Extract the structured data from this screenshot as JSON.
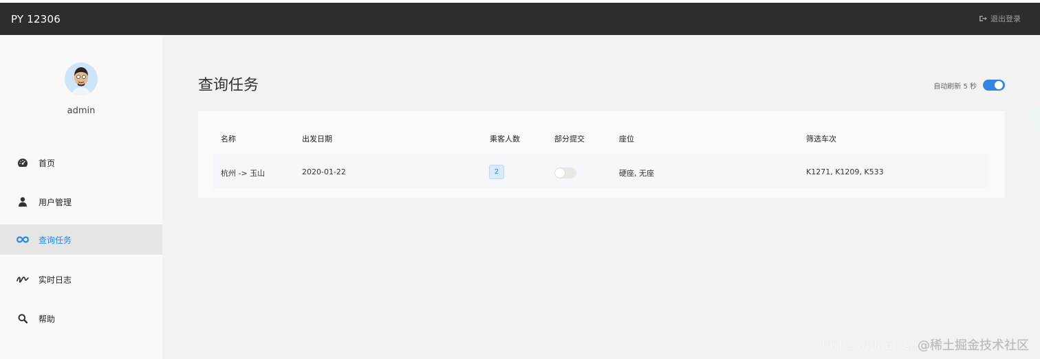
{
  "header": {
    "brand": "PY 12306",
    "logout_label": "退出登录"
  },
  "user": {
    "name": "admin"
  },
  "sidebar": {
    "items": [
      {
        "label": "首页",
        "icon": "dashboard-icon"
      },
      {
        "label": "用户管理",
        "icon": "user-icon"
      },
      {
        "label": "查询任务",
        "icon": "infinity-icon",
        "active": true
      },
      {
        "label": "实时日志",
        "icon": "signal-icon"
      },
      {
        "label": "帮助",
        "icon": "search-icon"
      }
    ]
  },
  "main": {
    "title": "查询任务",
    "auto_refresh_label": "自动刷新 5 秒",
    "auto_refresh_enabled": true,
    "table": {
      "columns": [
        "名称",
        "出发日期",
        "乘客人数",
        "部分提交",
        "座位",
        "筛选车次"
      ],
      "rows": [
        {
          "name": "杭州 -> 玉山",
          "date": "2020-01-22",
          "passengers": "2",
          "partial_submit": false,
          "seats": "硬座, 无座",
          "trains": "K1271, K1209, K533"
        }
      ]
    }
  },
  "watermark": {
    "url": "https://blog.csd",
    "cn": "@稀土掘金技术社区"
  },
  "colors": {
    "accent": "#2f86e5",
    "topbar": "#2d2d2d",
    "sidebar_active_bg": "#e5e5e5"
  }
}
